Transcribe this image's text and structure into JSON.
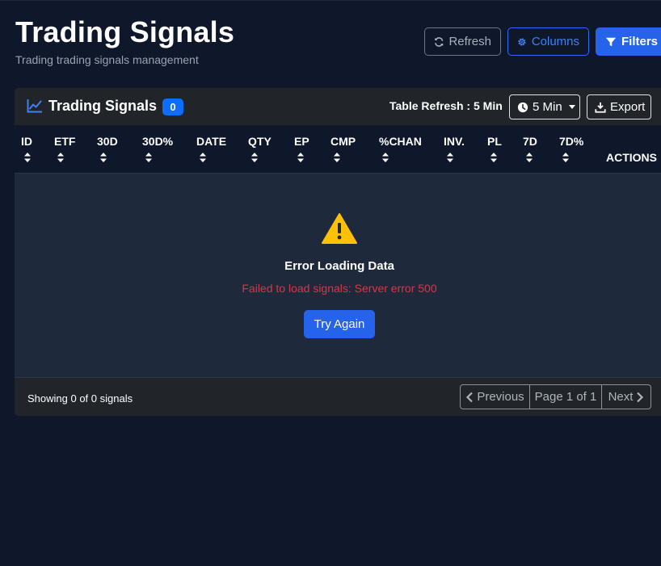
{
  "header": {
    "title": "Trading Signals",
    "subtitle": "Trading trading signals management",
    "refresh_label": "Refresh",
    "columns_label": "Columns",
    "filters_label": "Filters"
  },
  "card": {
    "title": "Trading Signals",
    "count": "0",
    "table_refresh_label": "Table Refresh : 5 Min",
    "interval_value": "5 Min",
    "export_label": "Export"
  },
  "table": {
    "columns": [
      "ID",
      "ETF",
      "30D",
      "30D%",
      "DATE",
      "QTY",
      "EP",
      "CMP",
      "%CHAN",
      "INV.",
      "PL",
      "7D",
      "7D%"
    ],
    "actions_label": "ACTIONS"
  },
  "error": {
    "title": "Error Loading Data",
    "message": "Failed to load signals: Server error 500",
    "retry_label": "Try Again"
  },
  "footer": {
    "showing": "Showing 0 of 0 signals",
    "previous_label": "Previous",
    "page_info": "Page 1 of 1",
    "next_label": "Next"
  },
  "colors": {
    "background": "#0f172a",
    "card": "#1e293b",
    "accent": "#2563eb",
    "error": "#dc3545",
    "warning": "#ffc107"
  },
  "icons": [
    "sync-icon",
    "gear-icon",
    "filter-icon",
    "chart-line-icon",
    "clock-icon",
    "download-icon",
    "sort-icon",
    "warning-icon",
    "chevron-left-icon",
    "chevron-right-icon"
  ]
}
